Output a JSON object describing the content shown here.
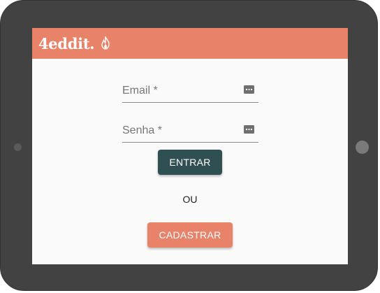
{
  "app": {
    "logo_text": "4eddit."
  },
  "login_form": {
    "email_label": "Email  *",
    "email_value": "",
    "password_label": "Senha  *",
    "password_value": "",
    "login_button": "ENTRAR",
    "divider": "OU",
    "signup_button": "CADASTRAR"
  },
  "colors": {
    "brand": "#e8836a",
    "primary_button": "#2f4f53",
    "device_frame": "#424242",
    "screen_background": "#fafafa"
  },
  "icons": {
    "field_icon": "password-dots-icon",
    "logo_icon": "flame-icon"
  }
}
